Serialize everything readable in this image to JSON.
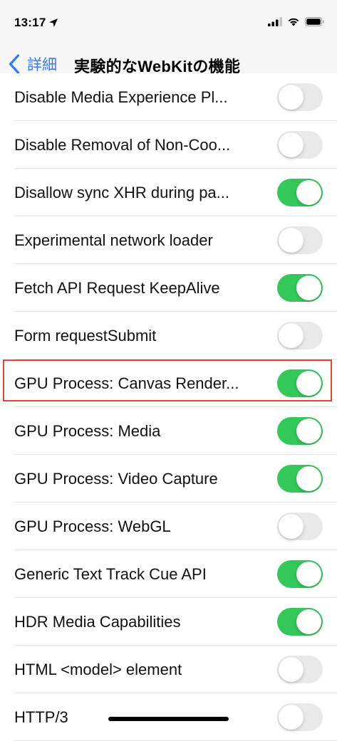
{
  "status_bar": {
    "time": "13:17",
    "icons": [
      "location-arrow-icon",
      "cellular-signal-icon",
      "wifi-icon",
      "battery-icon"
    ]
  },
  "nav": {
    "back_label": "詳細",
    "title": "実験的なWebKitの機能"
  },
  "colors": {
    "accent": "#2f7cf6",
    "toggle_on": "#34c759",
    "toggle_off": "#e9e9eb",
    "highlight": "#e2462f"
  },
  "settings": [
    {
      "label": "Disable Media Experience Pl...",
      "on": false
    },
    {
      "label": "Disable Removal of Non-Coo...",
      "on": false
    },
    {
      "label": "Disallow sync XHR during pa...",
      "on": true
    },
    {
      "label": "Experimental network loader",
      "on": false
    },
    {
      "label": "Fetch API Request KeepAlive",
      "on": true
    },
    {
      "label": "Form requestSubmit",
      "on": false
    },
    {
      "label": "GPU Process: Canvas Render...",
      "on": true,
      "highlighted": true
    },
    {
      "label": "GPU Process: Media",
      "on": true
    },
    {
      "label": "GPU Process: Video Capture",
      "on": true
    },
    {
      "label": "GPU Process: WebGL",
      "on": false
    },
    {
      "label": "Generic Text Track Cue API",
      "on": true
    },
    {
      "label": "HDR Media Capabilities",
      "on": true
    },
    {
      "label": "HTML <model> element",
      "on": false
    },
    {
      "label": "HTTP/3",
      "on": false
    }
  ]
}
